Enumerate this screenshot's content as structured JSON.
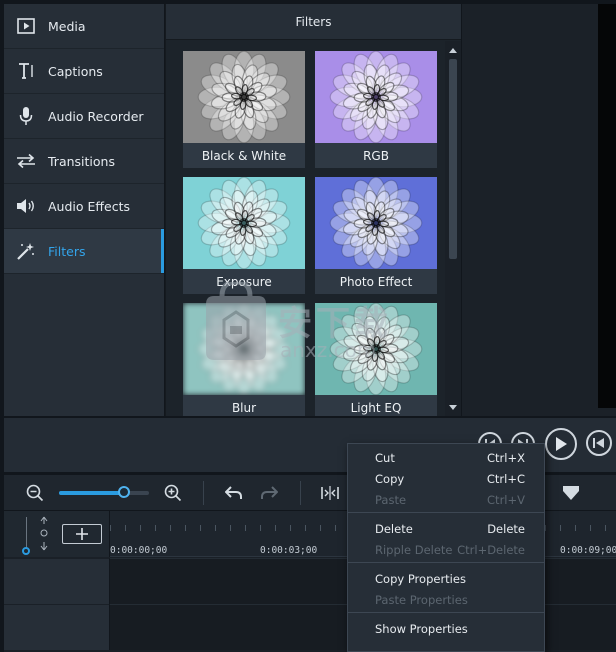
{
  "sidebar": {
    "items": [
      {
        "label": "Media",
        "icon": "media-icon"
      },
      {
        "label": "Captions",
        "icon": "text-icon"
      },
      {
        "label": "Audio Recorder",
        "icon": "microphone-icon"
      },
      {
        "label": "Transitions",
        "icon": "transitions-icon"
      },
      {
        "label": "Audio Effects",
        "icon": "speaker-icon"
      },
      {
        "label": "Filters",
        "icon": "magic-wand-icon",
        "active": true
      }
    ]
  },
  "filters": {
    "title": "Filters",
    "tiles": [
      {
        "label": "Black & White",
        "tint": "#8b8b8b"
      },
      {
        "label": "RGB",
        "tint": "#a98ee8"
      },
      {
        "label": "Exposure",
        "tint": "#7fd2d6"
      },
      {
        "label": "Photo Effect",
        "tint": "#5f6fd8"
      },
      {
        "label": "Blur",
        "tint": "#8fc4c0"
      },
      {
        "label": "Light EQ",
        "tint": "#6fb6b0"
      }
    ]
  },
  "toolbar": {
    "zoom_level": 0.72
  },
  "timeline": {
    "timestamps": [
      "0:00:00;00",
      "0:00:03;00",
      "0:00:09;00"
    ]
  },
  "context_menu": {
    "items": [
      {
        "label": "Cut",
        "shortcut": "Ctrl+X",
        "enabled": true
      },
      {
        "label": "Copy",
        "shortcut": "Ctrl+C",
        "enabled": true
      },
      {
        "label": "Paste",
        "shortcut": "Ctrl+V",
        "enabled": false
      },
      {
        "label": "Delete",
        "shortcut": "Delete",
        "enabled": true
      },
      {
        "label": "Ripple Delete",
        "shortcut": "Ctrl+Delete",
        "enabled": false
      },
      {
        "label": "Copy Properties",
        "shortcut": "",
        "enabled": true
      },
      {
        "label": "Paste Properties",
        "shortcut": "",
        "enabled": false
      },
      {
        "label": "Show Properties",
        "shortcut": "",
        "enabled": true
      }
    ]
  },
  "watermark": {
    "text": "安下载",
    "url": "anxz.com"
  },
  "colors": {
    "accent": "#2a9be0",
    "panel": "#262e37",
    "background": "#11161c"
  }
}
